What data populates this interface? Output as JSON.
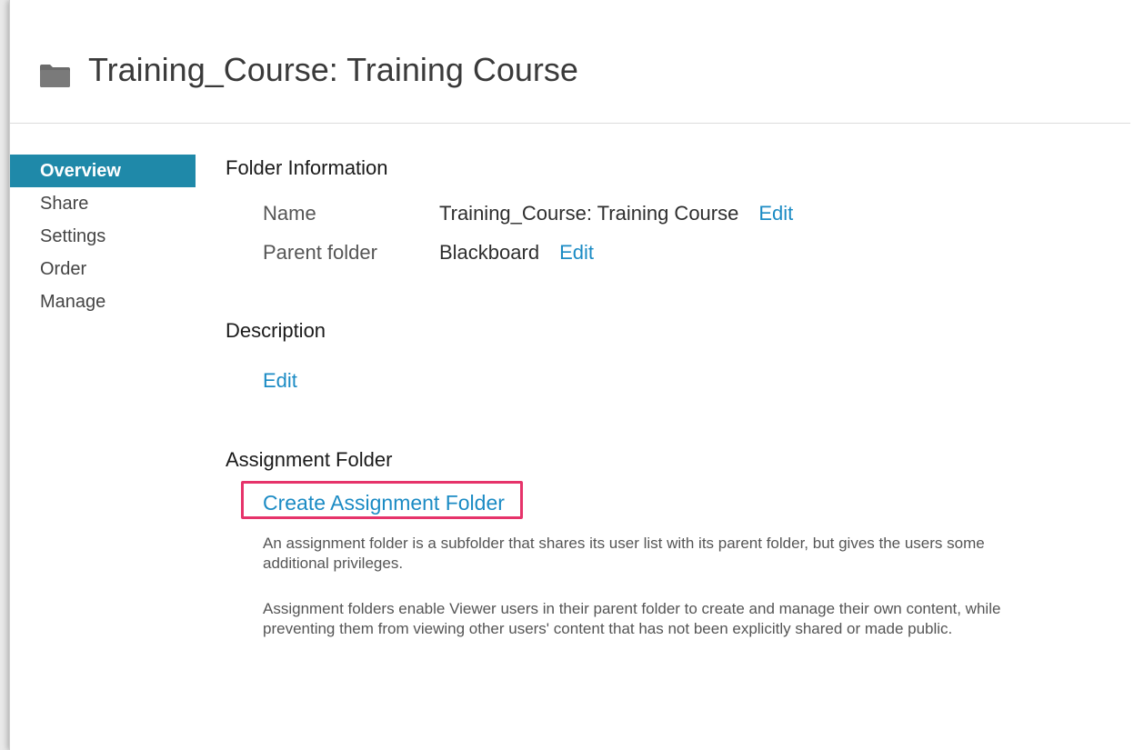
{
  "header": {
    "title": "Training_Course: Training Course",
    "icon": "folder-icon"
  },
  "sidebar": {
    "items": [
      {
        "label": "Overview",
        "active": true
      },
      {
        "label": "Share",
        "active": false
      },
      {
        "label": "Settings",
        "active": false
      },
      {
        "label": "Order",
        "active": false
      },
      {
        "label": "Manage",
        "active": false
      }
    ]
  },
  "folder_info": {
    "heading": "Folder Information",
    "name_label": "Name",
    "name_value": "Training_Course: Training Course",
    "name_edit": "Edit",
    "parent_label": "Parent folder",
    "parent_value": "Blackboard",
    "parent_edit": "Edit"
  },
  "description": {
    "heading": "Description",
    "edit": "Edit"
  },
  "assignment": {
    "heading": "Assignment Folder",
    "create_link": "Create Assignment Folder",
    "help_1": "An assignment folder is a subfolder that shares its user list with its parent folder, but gives the users some additional privileges.",
    "help_2": "Assignment folders enable Viewer users in their parent folder to create and manage their own content, while preventing them from viewing other users' content that has not been explicitly shared or made public."
  },
  "colors": {
    "accent": "#1f89a9",
    "link": "#1b8bc4",
    "highlight": "#e6336a"
  }
}
